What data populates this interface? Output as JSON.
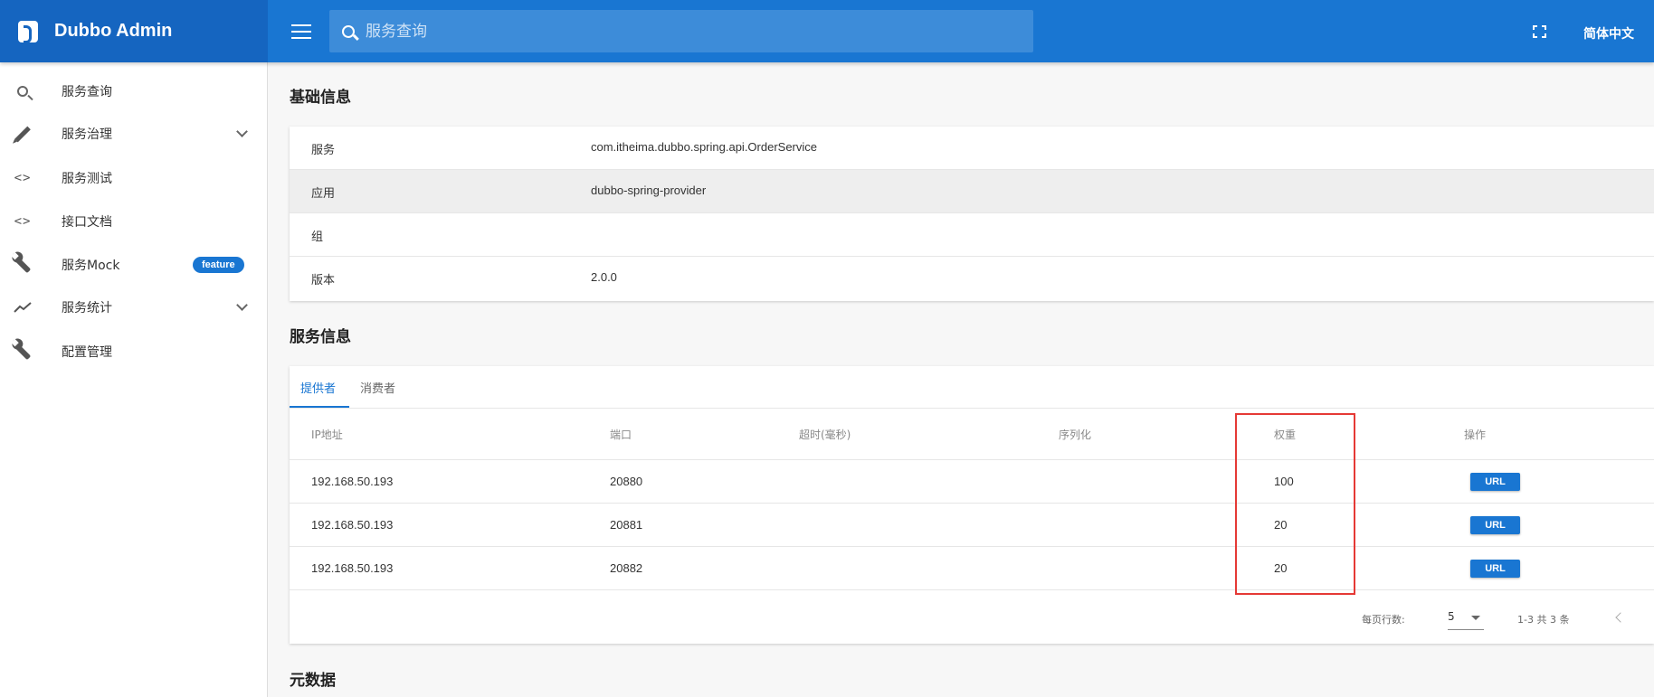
{
  "header": {
    "title": "Dubbo Admin",
    "search_placeholder": "服务查询",
    "language": "简体中文"
  },
  "sidebar": {
    "items": [
      {
        "label": "服务查询",
        "icon": "search-icon"
      },
      {
        "label": "服务治理",
        "icon": "pencil-icon",
        "expandable": true
      },
      {
        "label": "服务测试",
        "icon": "code-icon"
      },
      {
        "label": "接口文档",
        "icon": "code-icon"
      },
      {
        "label": "服务Mock",
        "icon": "wrench-icon",
        "badge": "feature"
      },
      {
        "label": "服务统计",
        "icon": "chart-line-icon",
        "expandable": true
      },
      {
        "label": "配置管理",
        "icon": "wrench-icon"
      }
    ]
  },
  "basic_info": {
    "title": "基础信息",
    "rows": [
      {
        "key": "服务",
        "value": "com.itheima.dubbo.spring.api.OrderService"
      },
      {
        "key": "应用",
        "value": "dubbo-spring-provider"
      },
      {
        "key": "组",
        "value": ""
      },
      {
        "key": "版本",
        "value": "2.0.0"
      }
    ]
  },
  "service_info": {
    "title": "服务信息",
    "tabs": [
      "提供者",
      "消费者"
    ],
    "active_tab": "提供者",
    "columns": [
      "IP地址",
      "端口",
      "超时(毫秒)",
      "序列化",
      "权重",
      "操作"
    ],
    "rows": [
      {
        "ip": "192.168.50.193",
        "port": "20880",
        "timeout": "",
        "serialization": "",
        "weight": "100",
        "action": "URL"
      },
      {
        "ip": "192.168.50.193",
        "port": "20881",
        "timeout": "",
        "serialization": "",
        "weight": "20",
        "action": "URL"
      },
      {
        "ip": "192.168.50.193",
        "port": "20882",
        "timeout": "",
        "serialization": "",
        "weight": "20",
        "action": "URL"
      }
    ],
    "pagination": {
      "rows_per_page_label": "每页行数:",
      "rows_per_page": "5",
      "range_text": "1-3 共 3 条"
    }
  },
  "metadata": {
    "title": "元数据"
  },
  "colors": {
    "primary": "#1976d2",
    "brand_bg": "#1565c0",
    "highlight": "#e53935"
  }
}
